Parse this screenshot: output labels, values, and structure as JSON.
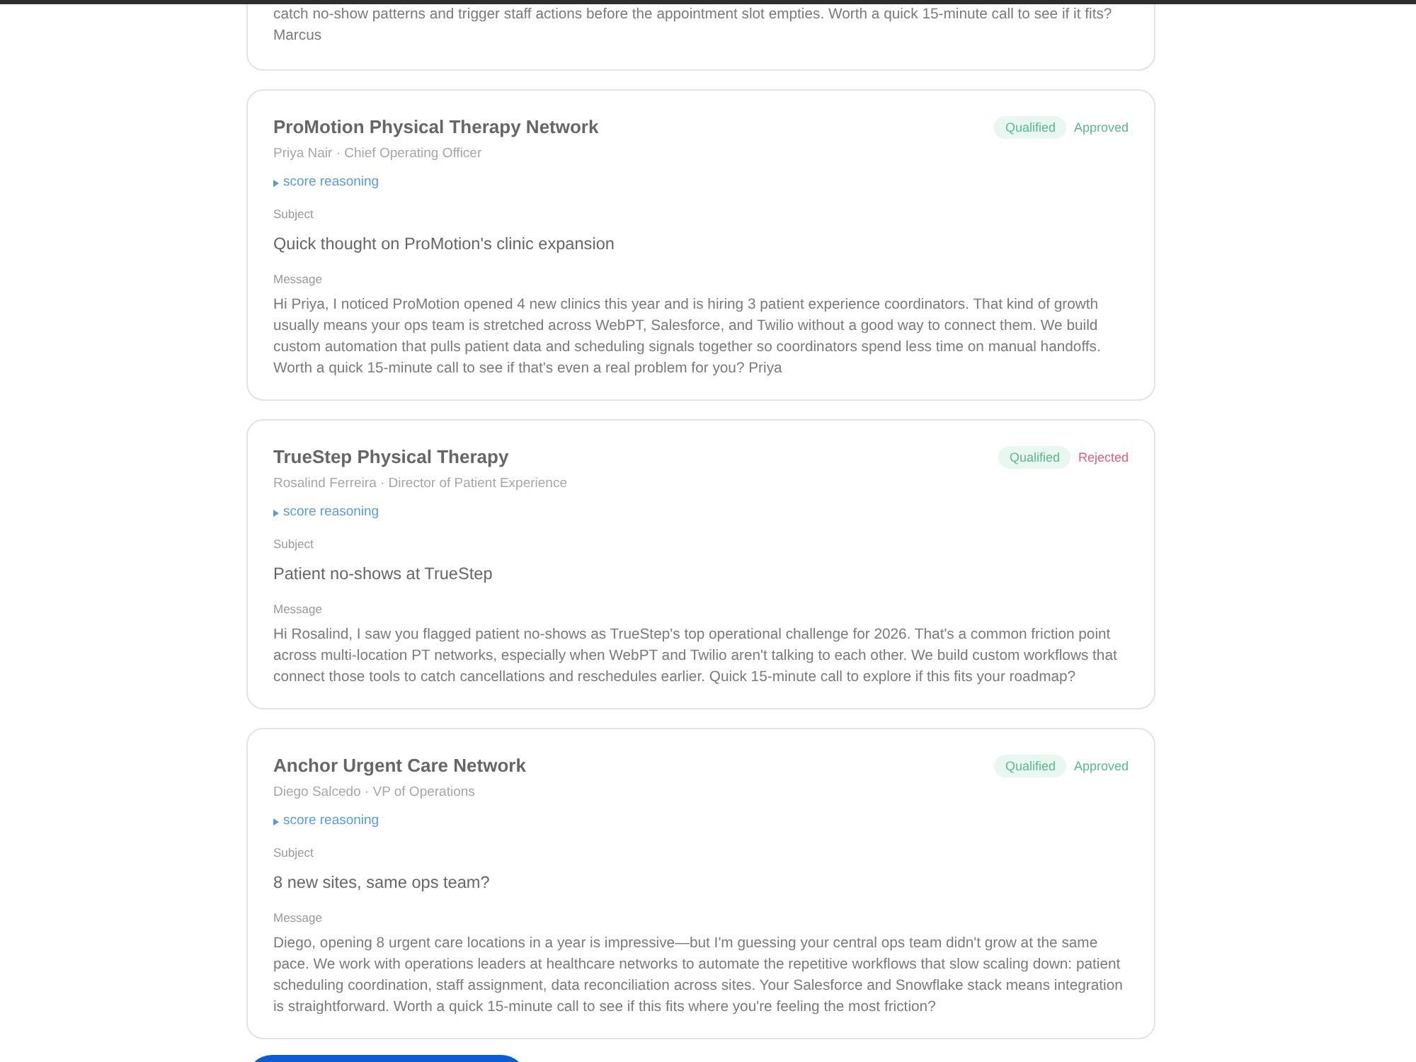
{
  "leads": [
    {
      "kind": "partial",
      "message": "catch no-show patterns and trigger staff actions before the appointment slot empties. Worth a quick 15-minute call to see if it fits? Marcus"
    },
    {
      "kind": "full",
      "company": "ProMotion Physical Therapy Network",
      "contact": "Priya Nair · Chief Operating Officer",
      "qualification": {
        "label": "Qualified",
        "kind": "qualified"
      },
      "review": {
        "label": "Approved",
        "kind": "approved"
      },
      "reasoning_toggle": {
        "label": "score reasoning",
        "expanded": false
      },
      "subject_label": "Subject",
      "subject": "Quick thought on ProMotion's clinic expansion",
      "message_label": "Message",
      "message": "Hi Priya, I noticed ProMotion opened 4 new clinics this year and is hiring 3 patient experience coordinators. That kind of growth usually means your ops team is stretched across WebPT, Salesforce, and Twilio without a good way to connect them. We build custom automation that pulls patient data and scheduling signals together so coordinators spend less time on manual handoffs. Worth a quick 15-minute call to see if that's even a real problem for you? Priya"
    },
    {
      "kind": "full",
      "company": "TrueStep Physical Therapy",
      "contact": "Rosalind Ferreira · Director of Patient Experience",
      "qualification": {
        "label": "Qualified",
        "kind": "qualified"
      },
      "review": {
        "label": "Rejected",
        "kind": "rejected"
      },
      "reasoning_toggle": {
        "label": "score reasoning",
        "expanded": false
      },
      "subject_label": "Subject",
      "subject": "Patient no-shows at TrueStep",
      "message_label": "Message",
      "message": "Hi Rosalind, I saw you flagged patient no-shows as TrueStep's top operational challenge for 2026. That's a common friction point across multi-location PT networks, especially when WebPT and Twilio aren't talking to each other. We build custom workflows that connect those tools to catch cancellations and reschedules earlier. Quick 15-minute call to explore if this fits your roadmap?"
    },
    {
      "kind": "full",
      "company": "Anchor Urgent Care Network",
      "contact": "Diego Salcedo · VP of Operations",
      "qualification": {
        "label": "Qualified",
        "kind": "qualified"
      },
      "review": {
        "label": "Approved",
        "kind": "approved"
      },
      "reasoning_toggle": {
        "label": "score reasoning",
        "expanded": false
      },
      "subject_label": "Subject",
      "subject": "8 new sites, same ops team?",
      "message_label": "Message",
      "message": "Diego, opening 8 urgent care locations in a year is impressive—but I'm guessing your central ops team didn't grow at the same pace. We work with operations leaders at healthcare networks to automate the repetitive workflows that slow scaling down: patient scheduling coordination, staff assignment, data reconciliation across sites. Your Salesforce and Snowflake stack means integration is straightforward. Worth a quick 15-minute call to see if this fits where you're feeling the most friction?"
    }
  ]
}
